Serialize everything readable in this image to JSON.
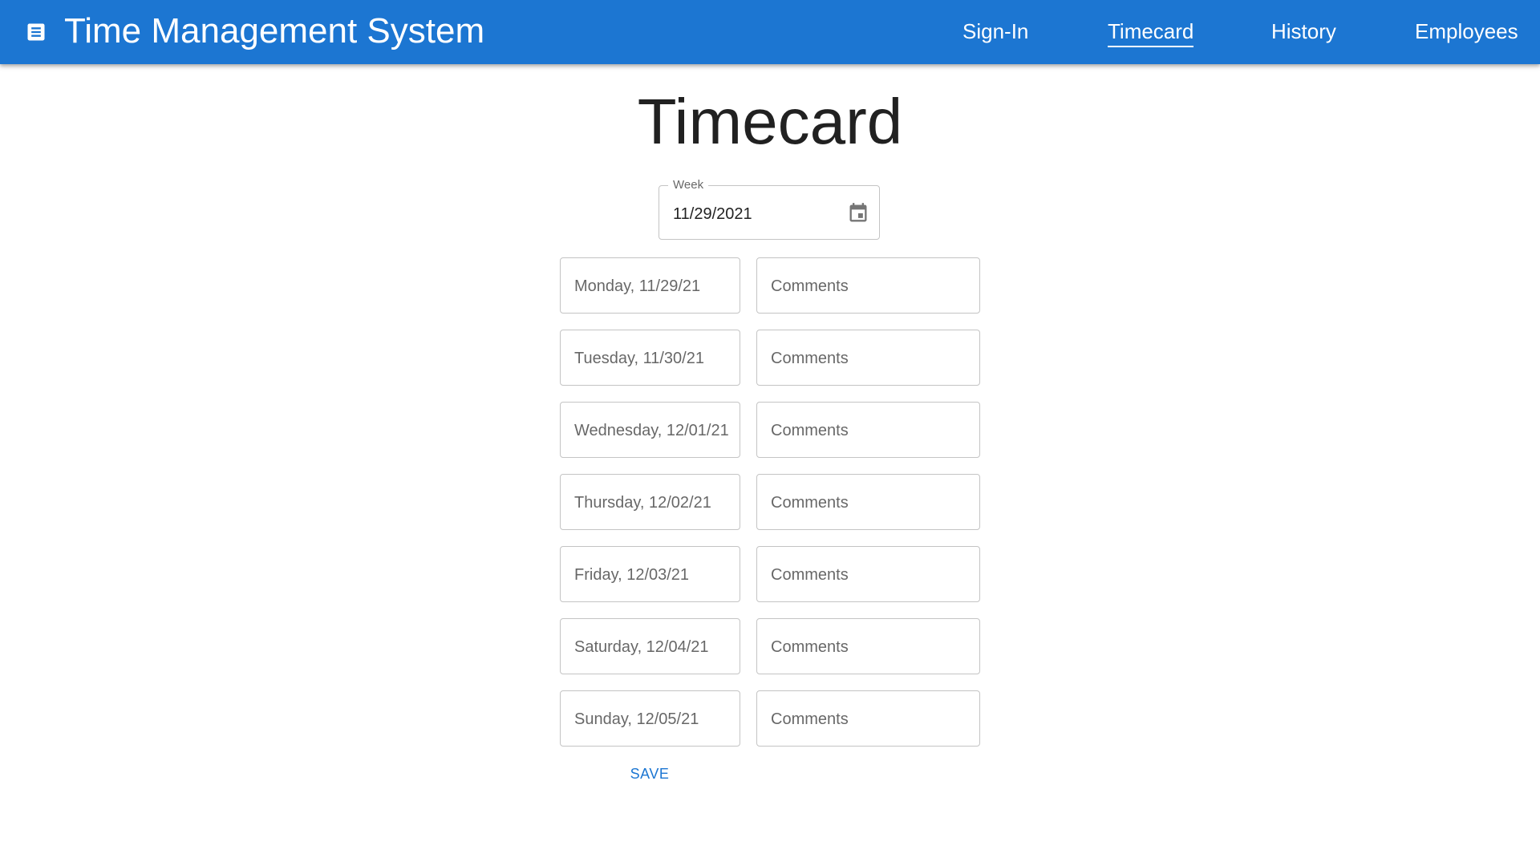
{
  "header": {
    "title": "Time Management System",
    "app_icon": "description-icon",
    "background_color": "#1c76d2"
  },
  "nav": [
    {
      "label": "Sign-In",
      "active": false
    },
    {
      "label": "Timecard",
      "active": true
    },
    {
      "label": "History",
      "active": false
    },
    {
      "label": "Employees",
      "active": false
    }
  ],
  "page": {
    "title": "Timecard"
  },
  "week": {
    "label": "Week",
    "value": "11/29/2021",
    "icon": "calendar-icon"
  },
  "days": [
    {
      "placeholder": "Monday, 11/29/21",
      "comment_placeholder": "Comments"
    },
    {
      "placeholder": "Tuesday, 11/30/21",
      "comment_placeholder": "Comments"
    },
    {
      "placeholder": "Wednesday, 12/01/21",
      "comment_placeholder": "Comments"
    },
    {
      "placeholder": "Thursday, 12/02/21",
      "comment_placeholder": "Comments"
    },
    {
      "placeholder": "Friday, 12/03/21",
      "comment_placeholder": "Comments"
    },
    {
      "placeholder": "Saturday, 12/04/21",
      "comment_placeholder": "Comments"
    },
    {
      "placeholder": "Sunday, 12/05/21",
      "comment_placeholder": "Comments"
    }
  ],
  "actions": {
    "save_label": "SAVE",
    "accent_color": "#1c76d2"
  }
}
